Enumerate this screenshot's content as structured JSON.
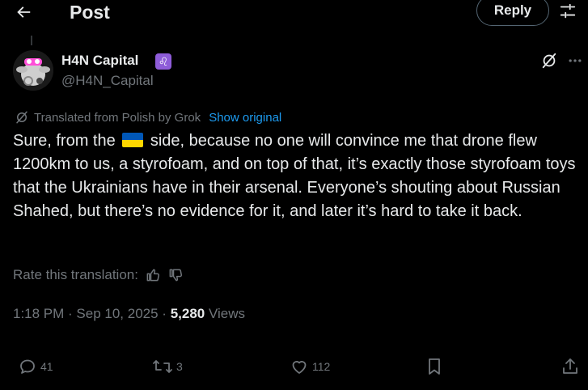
{
  "header": {
    "title": "Post",
    "reply_label": "Reply"
  },
  "author": {
    "name": "H4N Capital",
    "badge": "♌",
    "handle": "@H4N_Capital"
  },
  "translation": {
    "note": "Translated from Polish by Grok",
    "show_original": "Show original"
  },
  "tweet": {
    "text_before_flag": " Sure, from the ",
    "flag": "ukraine-flag",
    "text_after_flag": " side, because no one will convince me that drone flew 1200km to us, a styrofoam, and on top of that, it’s exactly those styrofoam toys that the Ukrainians have in their arsenal. Everyone’s shouting about Russian Shahed, but there’s no evidence for it, and later it’s hard to take it back."
  },
  "rate": {
    "label": "Rate this translation:"
  },
  "meta": {
    "time": "1:18 PM",
    "sep1": " · ",
    "date": "Sep 10, 2025",
    "sep2": " · ",
    "views_count": "5,280",
    "views_label": " Views"
  },
  "actions": {
    "replies": "41",
    "reposts": "3",
    "likes": "112"
  },
  "colors": {
    "background": "#000000",
    "text": "#e7e9ea",
    "muted": "#71767b",
    "accent": "#1d9bf0",
    "badge": "#8e5cd9",
    "flag_blue": "#0057b7",
    "flag_yellow": "#ffd700"
  }
}
